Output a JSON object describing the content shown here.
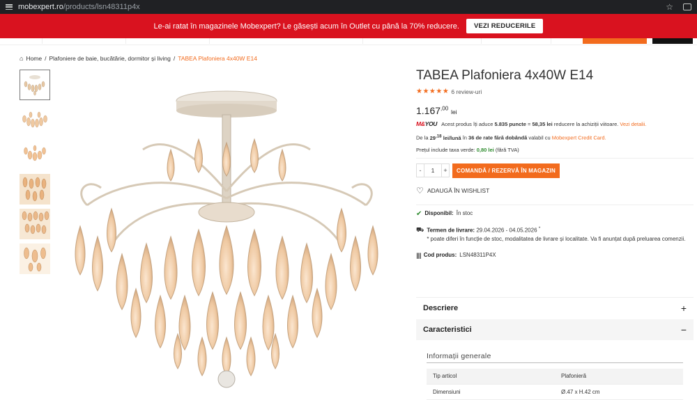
{
  "browser": {
    "url_host": "mobexpert.ro",
    "url_path": "/products/lsn48311p4x"
  },
  "promo": {
    "text": "Le-ai ratat în magazinele Mobexpert? Le găsești acum în Outlet cu până la 70% reducere.",
    "button": "VEZI REDUCERILE"
  },
  "breadcrumb": {
    "home": "Home",
    "category": "Plafoniere de baie, bucătărie, dormitor și living",
    "current": "TABEA Plafoniera 4x40W E14",
    "separator": "/"
  },
  "product": {
    "title": "TABEA Plafoniera 4x40W E14",
    "stars": "★★★★★",
    "reviews": "6 review-uri",
    "price_main": "1.167",
    "price_decimals": ",00",
    "currency": "lei",
    "loyalty_logo_a": "M&",
    "loyalty_logo_b": "YOU",
    "loyalty_text_1": "Acest produs îți aduce",
    "loyalty_points": "5.835 puncte",
    "loyalty_eq": "=",
    "loyalty_value": "58,35 lei",
    "loyalty_text_2": "reducere la achiziții viitoare.",
    "loyalty_link": "Vezi detalii.",
    "credit_pre": "De la",
    "credit_amount": "29",
    "credit_sup": ",18",
    "credit_unit": "lei/lună",
    "credit_mid": "în",
    "credit_rates": "36 de rate fără dobândă",
    "credit_post": "valabil cu",
    "credit_link": "Mobexpert Credit Card.",
    "tax_pre": "Prețul include taxa verde:",
    "tax_value": "0,80 lei",
    "tax_post": "(fără TVA)",
    "qty_minus": "-",
    "qty": "1",
    "qty_plus": "+",
    "order_button": "COMANDĂ / REZERVĂ ÎN MAGAZIN",
    "wishlist": "ADAUGĂ ÎN WISHLIST",
    "availability_label": "Disponibil:",
    "availability_value": "În stoc",
    "delivery_label": "Termen de livrare:",
    "delivery_value": "29.04.2026 - 04.05.2026",
    "delivery_star": "*",
    "delivery_note": "* poate diferi în funcție de stoc, modalitatea de livrare și localitate. Va fi anunțat după preluarea comenzii.",
    "code_label": "Cod produs:",
    "code_value": "LSN48311P4X"
  },
  "accordion": {
    "description": "Descriere",
    "description_sign": "+",
    "characteristics": "Caracteristici",
    "characteristics_sign": "−"
  },
  "specs": {
    "heading": "Informații generale",
    "rows": [
      {
        "label": "Tip articol",
        "value": "Plafonieră"
      },
      {
        "label": "Dimensiuni",
        "value": "Ø.47 x H.42 cm"
      }
    ]
  },
  "colors": {
    "brand_red": "#d9121f",
    "accent_orange": "#f26b1d",
    "in_stock_green": "#2e8b2e"
  },
  "icons": [
    "tune-icon",
    "star-bookmark-icon",
    "extension-icon",
    "home-icon",
    "heart-icon",
    "check-icon",
    "truck-icon",
    "barcode-icon",
    "plus-icon",
    "minus-icon"
  ]
}
